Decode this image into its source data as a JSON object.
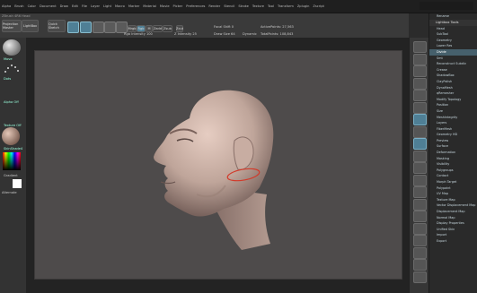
{
  "menubar": {
    "items": [
      "Alpha",
      "Brush",
      "Color",
      "Document",
      "Draw",
      "Edit",
      "File",
      "Layer",
      "Light",
      "Macro",
      "Marker",
      "Material",
      "Movie",
      "Picker",
      "Preferences",
      "Render",
      "Stencil",
      "Stroke",
      "Texture",
      "Tool",
      "Transform",
      "Zplugin",
      "Zscript"
    ]
  },
  "title_strip": "ZBrush 4R6 Head",
  "toolbar": {
    "projection_master": "Projection Master",
    "lightbox": "LightBox",
    "quick_sketch": "Quick Sketch",
    "edit": "Edit",
    "draw": "Draw",
    "move": "Move",
    "scale": "Scale",
    "rotate": "Rotate",
    "mrgb": "Mrgb",
    "rgb": "Rgb",
    "m": "M",
    "zadd": "Zadd",
    "zsub": "Zsub",
    "zcut": "Zcut",
    "focal_shift": "Focal Shift 0",
    "draw_size": "Draw Size 64",
    "dynamic": "Dynamic",
    "rgb_intensity": "Rgb Intensity 100",
    "z_intensity": "Z Intensity 25",
    "active_points": "ActivePoints: 27,563",
    "total_points": "TotalPoints: 108,843",
    "rgb_fill": 1.0,
    "z_fill": 0.25
  },
  "left_shelf": {
    "brush_label": "Move",
    "stroke_label": "Dots",
    "alpha_label": "Alpha Off",
    "texture_label": "Texture Off",
    "material_label": "SkinShade4",
    "gradient_label": "Gradient",
    "switch_label": "SwitchColor",
    "alternate_label": "Alternate"
  },
  "right_tray": {
    "sections": [
      {
        "label": "Rename",
        "kind": "btn"
      },
      {
        "label": "Lightbox Tools",
        "kind": "hdr"
      },
      {
        "label": "Head",
        "kind": "item"
      },
      {
        "label": "SubTool",
        "kind": "item"
      },
      {
        "label": "Geometry",
        "kind": "item"
      },
      {
        "label": "Lower Res",
        "kind": "item"
      },
      {
        "label": "Divide",
        "kind": "sel"
      },
      {
        "label": "Smt",
        "kind": "item"
      },
      {
        "label": "Reconstruct Subdiv",
        "kind": "item"
      },
      {
        "label": "Crease",
        "kind": "item"
      },
      {
        "label": "ShadowBox",
        "kind": "item"
      },
      {
        "label": "ClayPolish",
        "kind": "item"
      },
      {
        "label": "DynaMesh",
        "kind": "item"
      },
      {
        "label": "qRemesher",
        "kind": "item"
      },
      {
        "label": "Modify Topology",
        "kind": "item"
      },
      {
        "label": "Position",
        "kind": "item"
      },
      {
        "label": "Size",
        "kind": "item"
      },
      {
        "label": "MeshIntegrity",
        "kind": "item"
      },
      {
        "label": "Layers",
        "kind": "item"
      },
      {
        "label": "FiberMesh",
        "kind": "item"
      },
      {
        "label": "Geometry HD",
        "kind": "item"
      },
      {
        "label": "Preview",
        "kind": "item"
      },
      {
        "label": "Surface",
        "kind": "item"
      },
      {
        "label": "Deformation",
        "kind": "item"
      },
      {
        "label": "Masking",
        "kind": "item"
      },
      {
        "label": "Visibility",
        "kind": "item"
      },
      {
        "label": "Polygroups",
        "kind": "item"
      },
      {
        "label": "Contact",
        "kind": "item"
      },
      {
        "label": "Morph Target",
        "kind": "item"
      },
      {
        "label": "Polypaint",
        "kind": "item"
      },
      {
        "label": "UV Map",
        "kind": "item"
      },
      {
        "label": "Texture Map",
        "kind": "item"
      },
      {
        "label": "Vector Displacement Map",
        "kind": "item"
      },
      {
        "label": "Displacement Map",
        "kind": "item"
      },
      {
        "label": "Normal Map",
        "kind": "item"
      },
      {
        "label": "Display Properties",
        "kind": "item"
      },
      {
        "label": "Unified Skin",
        "kind": "item"
      },
      {
        "label": "Import",
        "kind": "item"
      },
      {
        "label": "Export",
        "kind": "item"
      }
    ]
  },
  "colors": {
    "accent": "#4f7f95",
    "canvas": "#4e4b4b",
    "head_skin": "#bfa59a",
    "annotation": "#d23a2a"
  }
}
